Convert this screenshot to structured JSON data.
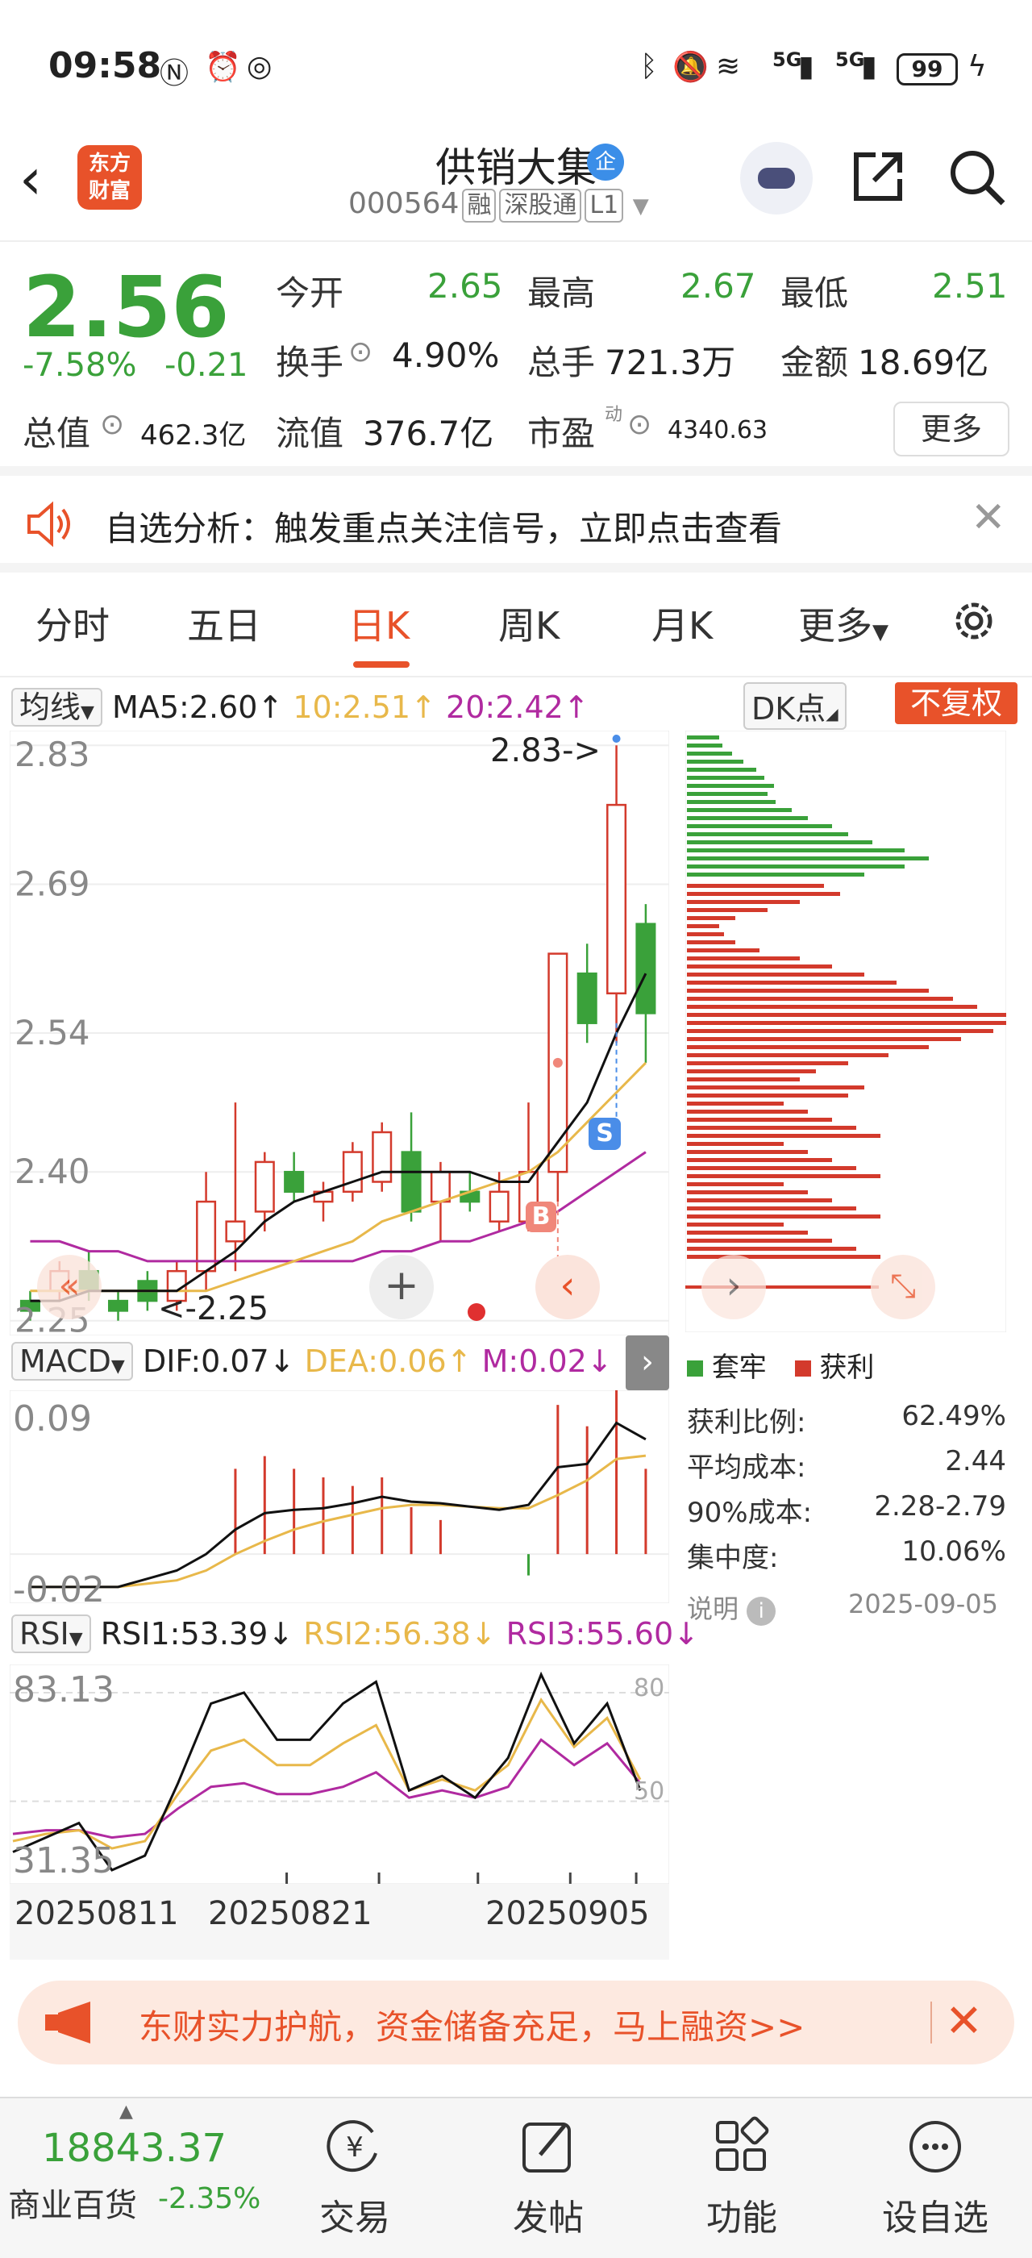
{
  "status_bar": {
    "time": "09:58",
    "battery": "99",
    "signal1": "5G",
    "signal2": "5G"
  },
  "header": {
    "logo_line1": "东方",
    "logo_line2": "财富",
    "stock_name": "供销大集",
    "ent_badge": "企",
    "stock_code": "000564",
    "tags": [
      "融",
      "深股通",
      "L1"
    ]
  },
  "quote": {
    "price": "2.56",
    "change_pct": "-7.58%",
    "change": "-0.21",
    "fields": [
      {
        "label": "今开",
        "value": "2.65",
        "color": "green"
      },
      {
        "label": "最高",
        "value": "2.67",
        "color": "green"
      },
      {
        "label": "最低",
        "value": "2.51",
        "color": "green"
      },
      {
        "label": "换手",
        "value": "4.90%",
        "color": "dark"
      },
      {
        "label": "总手",
        "value": "721.3万",
        "color": "dark"
      },
      {
        "label": "金额",
        "value": "18.69亿",
        "color": "dark"
      },
      {
        "label": "总值",
        "value": "462.3亿",
        "color": "dark"
      },
      {
        "label": "流值",
        "value": "376.7亿",
        "color": "dark"
      },
      {
        "label": "市盈",
        "value": "4340.63",
        "color": "dark"
      }
    ],
    "pe_sup": "动",
    "more_label": "更多"
  },
  "notice": {
    "text": "自选分析：触发重点关注信号，立即点击查看"
  },
  "tabs": [
    "分时",
    "五日",
    "日K",
    "周K",
    "月K",
    "更多"
  ],
  "active_tab": "日K",
  "ma_row": {
    "select": "均线",
    "ma5": "MA5:2.60↑",
    "ma10": "10:2.51↑",
    "ma20": "20:2.42↑",
    "dk": "DK点",
    "fq": "不复权"
  },
  "kline": {
    "price_labels": [
      "2.83",
      "2.69",
      "2.54",
      "2.40",
      "2.25"
    ],
    "high_marker": "2.83->",
    "low_marker": "<-2.25",
    "signal_s": "S",
    "signal_b": "B",
    "candles": [
      {
        "o": 2.27,
        "c": 2.26,
        "h": 2.28,
        "l": 2.25
      },
      {
        "o": 2.28,
        "c": 2.3,
        "h": 2.31,
        "l": 2.27
      },
      {
        "o": 2.3,
        "c": 2.28,
        "h": 2.32,
        "l": 2.27
      },
      {
        "o": 2.27,
        "c": 2.26,
        "h": 2.28,
        "l": 2.25
      },
      {
        "o": 2.29,
        "c": 2.27,
        "h": 2.3,
        "l": 2.26
      },
      {
        "o": 2.27,
        "c": 2.3,
        "h": 2.31,
        "l": 2.26
      },
      {
        "o": 2.3,
        "c": 2.37,
        "h": 2.4,
        "l": 2.28
      },
      {
        "o": 2.33,
        "c": 2.35,
        "h": 2.47,
        "l": 2.3
      },
      {
        "o": 2.36,
        "c": 2.41,
        "h": 2.42,
        "l": 2.34
      },
      {
        "o": 2.4,
        "c": 2.38,
        "h": 2.42,
        "l": 2.37
      },
      {
        "o": 2.37,
        "c": 2.38,
        "h": 2.39,
        "l": 2.35
      },
      {
        "o": 2.38,
        "c": 2.42,
        "h": 2.43,
        "l": 2.37
      },
      {
        "o": 2.39,
        "c": 2.44,
        "h": 2.45,
        "l": 2.38
      },
      {
        "o": 2.42,
        "c": 2.36,
        "h": 2.46,
        "l": 2.35
      },
      {
        "o": 2.37,
        "c": 2.4,
        "h": 2.41,
        "l": 2.33
      },
      {
        "o": 2.38,
        "c": 2.37,
        "h": 2.4,
        "l": 2.36
      },
      {
        "o": 2.35,
        "c": 2.38,
        "h": 2.4,
        "l": 2.34
      },
      {
        "o": 2.35,
        "c": 2.4,
        "h": 2.47,
        "l": 2.34
      },
      {
        "o": 2.4,
        "c": 2.62,
        "h": 2.62,
        "l": 2.37
      },
      {
        "o": 2.6,
        "c": 2.55,
        "h": 2.63,
        "l": 2.53
      },
      {
        "o": 2.58,
        "c": 2.77,
        "h": 2.83,
        "l": 2.53
      },
      {
        "o": 2.65,
        "c": 2.56,
        "h": 2.67,
        "l": 2.51
      }
    ],
    "ma5": [
      2.27,
      2.27,
      2.28,
      2.28,
      2.28,
      2.28,
      2.3,
      2.32,
      2.35,
      2.37,
      2.38,
      2.39,
      2.4,
      2.4,
      2.4,
      2.4,
      2.39,
      2.39,
      2.43,
      2.47,
      2.54,
      2.6
    ],
    "ma10": [
      2.28,
      2.28,
      2.28,
      2.28,
      2.28,
      2.28,
      2.28,
      2.29,
      2.3,
      2.31,
      2.32,
      2.33,
      2.35,
      2.36,
      2.37,
      2.38,
      2.39,
      2.4,
      2.42,
      2.45,
      2.48,
      2.51
    ],
    "ma20": [
      2.33,
      2.33,
      2.32,
      2.32,
      2.31,
      2.31,
      2.31,
      2.31,
      2.31,
      2.31,
      2.31,
      2.31,
      2.32,
      2.32,
      2.33,
      2.33,
      2.34,
      2.35,
      2.36,
      2.38,
      2.4,
      2.42
    ]
  },
  "macd_row": {
    "select": "MACD",
    "dif": "DIF:0.07↓",
    "dea": "DEA:0.06↑",
    "m": "M:0.02↓"
  },
  "macd": {
    "labels": [
      "0.09",
      "-0.02"
    ],
    "dif": [
      -0.02,
      -0.02,
      -0.02,
      -0.02,
      -0.015,
      -0.01,
      0.0,
      0.015,
      0.025,
      0.027,
      0.028,
      0.031,
      0.035,
      0.032,
      0.031,
      0.029,
      0.027,
      0.03,
      0.053,
      0.055,
      0.08,
      0.07
    ],
    "dea": [
      -0.02,
      -0.02,
      -0.02,
      -0.02,
      -0.018,
      -0.016,
      -0.01,
      0.0,
      0.008,
      0.015,
      0.02,
      0.024,
      0.028,
      0.03,
      0.03,
      0.029,
      0.028,
      0.028,
      0.036,
      0.045,
      0.058,
      0.06
    ],
    "m": [
      0.0,
      0.0,
      0.0,
      0.0,
      0.0,
      0.0,
      0.0,
      0.02,
      0.023,
      0.02,
      0.018,
      0.016,
      0.018,
      0.011,
      0.008,
      0.0,
      0.0,
      -0.005,
      0.035,
      0.03,
      0.045,
      0.02
    ]
  },
  "rsi_row": {
    "select": "RSI",
    "rsi1": "RSI1:53.39↓",
    "rsi2": "RSI2:56.38↓",
    "rsi3": "RSI3:55.60↓"
  },
  "rsi": {
    "labels": [
      "83.13",
      "31.35"
    ],
    "ref_labels": [
      "80",
      "50"
    ],
    "rsi1": [
      36,
      40,
      44,
      31,
      35,
      55,
      77,
      80,
      67,
      67,
      77,
      83,
      53,
      57,
      51,
      62,
      85,
      66,
      77,
      53
    ],
    "rsi2": [
      39,
      41,
      42,
      37,
      39,
      52,
      64,
      67,
      60,
      60,
      66,
      71,
      53,
      56,
      53,
      60,
      78,
      65,
      73,
      56
    ],
    "rsi3": [
      41,
      42,
      42,
      40,
      41,
      48,
      54,
      55,
      52,
      52,
      54,
      58,
      51,
      53,
      51,
      54,
      67,
      60,
      66,
      55
    ],
    "dates": [
      "20250811",
      "20250821",
      "20250905"
    ]
  },
  "chips": {
    "legend_hold": "套牢",
    "legend_profit": "获利",
    "rows": [
      {
        "label": "获利比例:",
        "value": "62.49%"
      },
      {
        "label": "平均成本:",
        "value": "2.44"
      },
      {
        "label": "90%成本:",
        "value": "2.28-2.79"
      },
      {
        "label": "集中度:",
        "value": "10.06%"
      }
    ],
    "note_label": "说明",
    "note_date": "2025-09-05",
    "green_bars": [
      40,
      44,
      56,
      70,
      86,
      96,
      108,
      100,
      110,
      130,
      150,
      180,
      200,
      230,
      270,
      300,
      270,
      220
    ],
    "red_bars": [
      170,
      190,
      140,
      100,
      60,
      40,
      46,
      60,
      90,
      140,
      180,
      220,
      260,
      300,
      330,
      360,
      400,
      420,
      380,
      340,
      300,
      250,
      200,
      160,
      140,
      220,
      200
    ]
  },
  "banner": {
    "text": "东财实力护航，资金储备充足，马上融资>>"
  },
  "bottom_nav": {
    "index_value": "18843.37",
    "index_name": "商业百货",
    "index_change": "-2.35%",
    "items": [
      "交易",
      "发帖",
      "功能",
      "设自选"
    ]
  },
  "colors": {
    "accent": "#e8522a",
    "up": "#d33a2c",
    "down": "#3aa13a",
    "ma10": "#e8b84a",
    "ma20": "#b02aa0"
  }
}
